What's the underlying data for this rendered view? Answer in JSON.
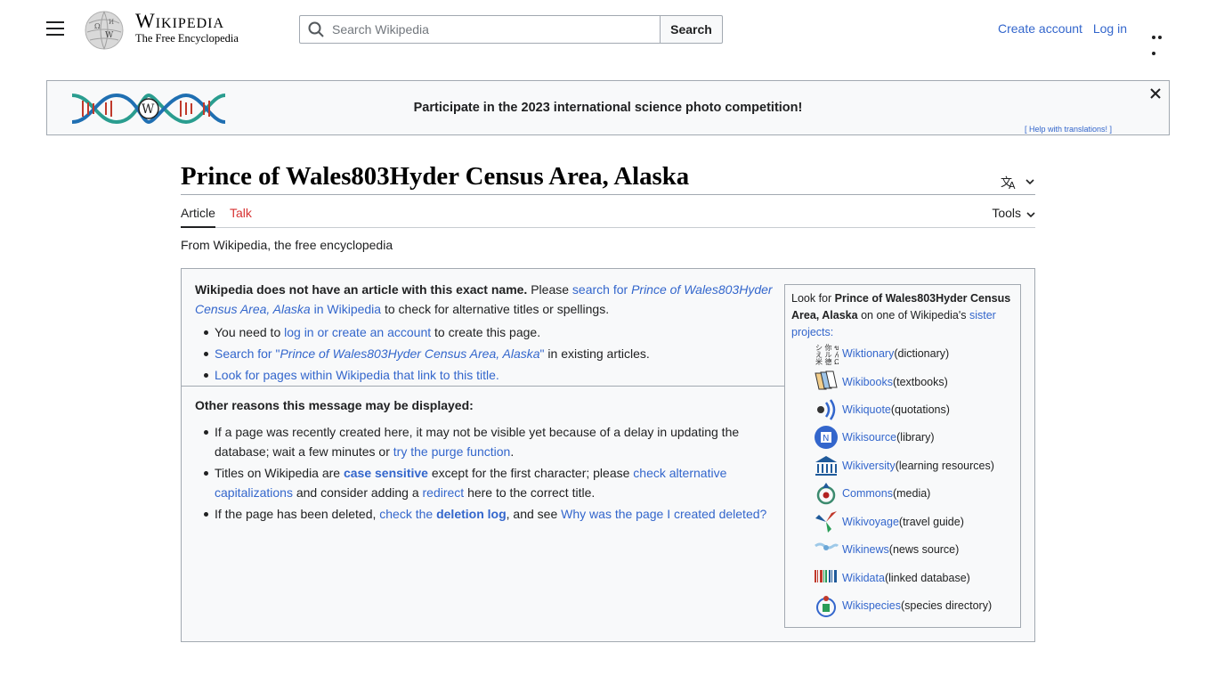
{
  "header": {
    "logo_title": "Wikipedia",
    "logo_tagline": "The Free Encyclopedia",
    "search_placeholder": "Search Wikipedia",
    "search_button": "Search",
    "create_account": "Create account",
    "log_in": "Log in"
  },
  "banner": {
    "message": "Participate in the 2023 international science photo competition!",
    "help_link": "[ Help with translations! ]"
  },
  "page": {
    "title": "Prince of Wales803Hyder Census Area, Alaska",
    "tabs": {
      "article": "Article",
      "talk": "Talk"
    },
    "tools": "Tools",
    "tagline": "From Wikipedia, the free encyclopedia"
  },
  "notice": {
    "intro_bold": "Wikipedia does not have an article with this exact name.",
    "intro_please": " Please ",
    "intro_link_1": "search for ",
    "intro_link_italic": "Prince of Wales803Hyder Census Area, Alaska",
    "intro_link_2": " in Wikipedia",
    "intro_tail": " to check for alternative titles or spellings.",
    "bullet1_pre": "You need to ",
    "bullet1_link": "log in or create an account",
    "bullet1_post": " to create this page.",
    "bullet2_link_pre": "Search for \"",
    "bullet2_link_italic": "Prince of Wales803Hyder Census Area, Alaska",
    "bullet2_link_post": "\"",
    "bullet2_post": " in existing articles.",
    "bullet3_link": "Look for pages within Wikipedia that link to this title.",
    "reasons_heading": "Other reasons this message may be displayed:",
    "r1_pre": "If a page was recently created here, it may not be visible yet because of a delay in updating the database; wait a few minutes or ",
    "r1_link": "try the purge function",
    "r1_post": ".",
    "r2_pre": "Titles on Wikipedia are ",
    "r2_bold_link": "case sensitive",
    "r2_mid": " except for the first character; please ",
    "r2_link2": "check alternative capitalizations",
    "r2_mid2": " and consider adding a ",
    "r2_link3": "redirect",
    "r2_post": " here to the correct title.",
    "r3_pre": "If the page has been deleted, ",
    "r3_link_pre": "check the ",
    "r3_link_bold": "deletion log",
    "r3_mid": ", and see ",
    "r3_link2": "Why was the page I created deleted?"
  },
  "sister": {
    "intro_pre": "Look for ",
    "intro_bold": "Prince of Wales803Hyder Census Area, Alaska",
    "intro_mid": " on one of Wikipedia's ",
    "intro_link": "sister projects",
    "intro_colon": ":",
    "items": [
      {
        "name": "Wiktionary",
        "desc": " (dictionary)",
        "icon": "wiktionary-icon"
      },
      {
        "name": "Wikibooks",
        "desc": " (textbooks)",
        "icon": "wikibooks-icon"
      },
      {
        "name": "Wikiquote",
        "desc": " (quotations)",
        "icon": "wikiquote-icon"
      },
      {
        "name": "Wikisource",
        "desc": " (library)",
        "icon": "wikisource-icon"
      },
      {
        "name": "Wikiversity",
        "desc": " (learning resources)",
        "icon": "wikiversity-icon"
      },
      {
        "name": "Commons",
        "desc": " (media)",
        "icon": "commons-icon"
      },
      {
        "name": "Wikivoyage",
        "desc": " (travel guide)",
        "icon": "wikivoyage-icon"
      },
      {
        "name": "Wikinews",
        "desc": " (news source)",
        "icon": "wikinews-icon"
      },
      {
        "name": "Wikidata",
        "desc": " (linked database)",
        "icon": "wikidata-icon"
      },
      {
        "name": "Wikispecies",
        "desc": " (species directory)",
        "icon": "wikispecies-icon"
      }
    ]
  },
  "colors": {
    "link": "#3366cc",
    "red_link": "#d73333",
    "border": "#a2a9b1",
    "box_bg": "#f8f9fa"
  }
}
